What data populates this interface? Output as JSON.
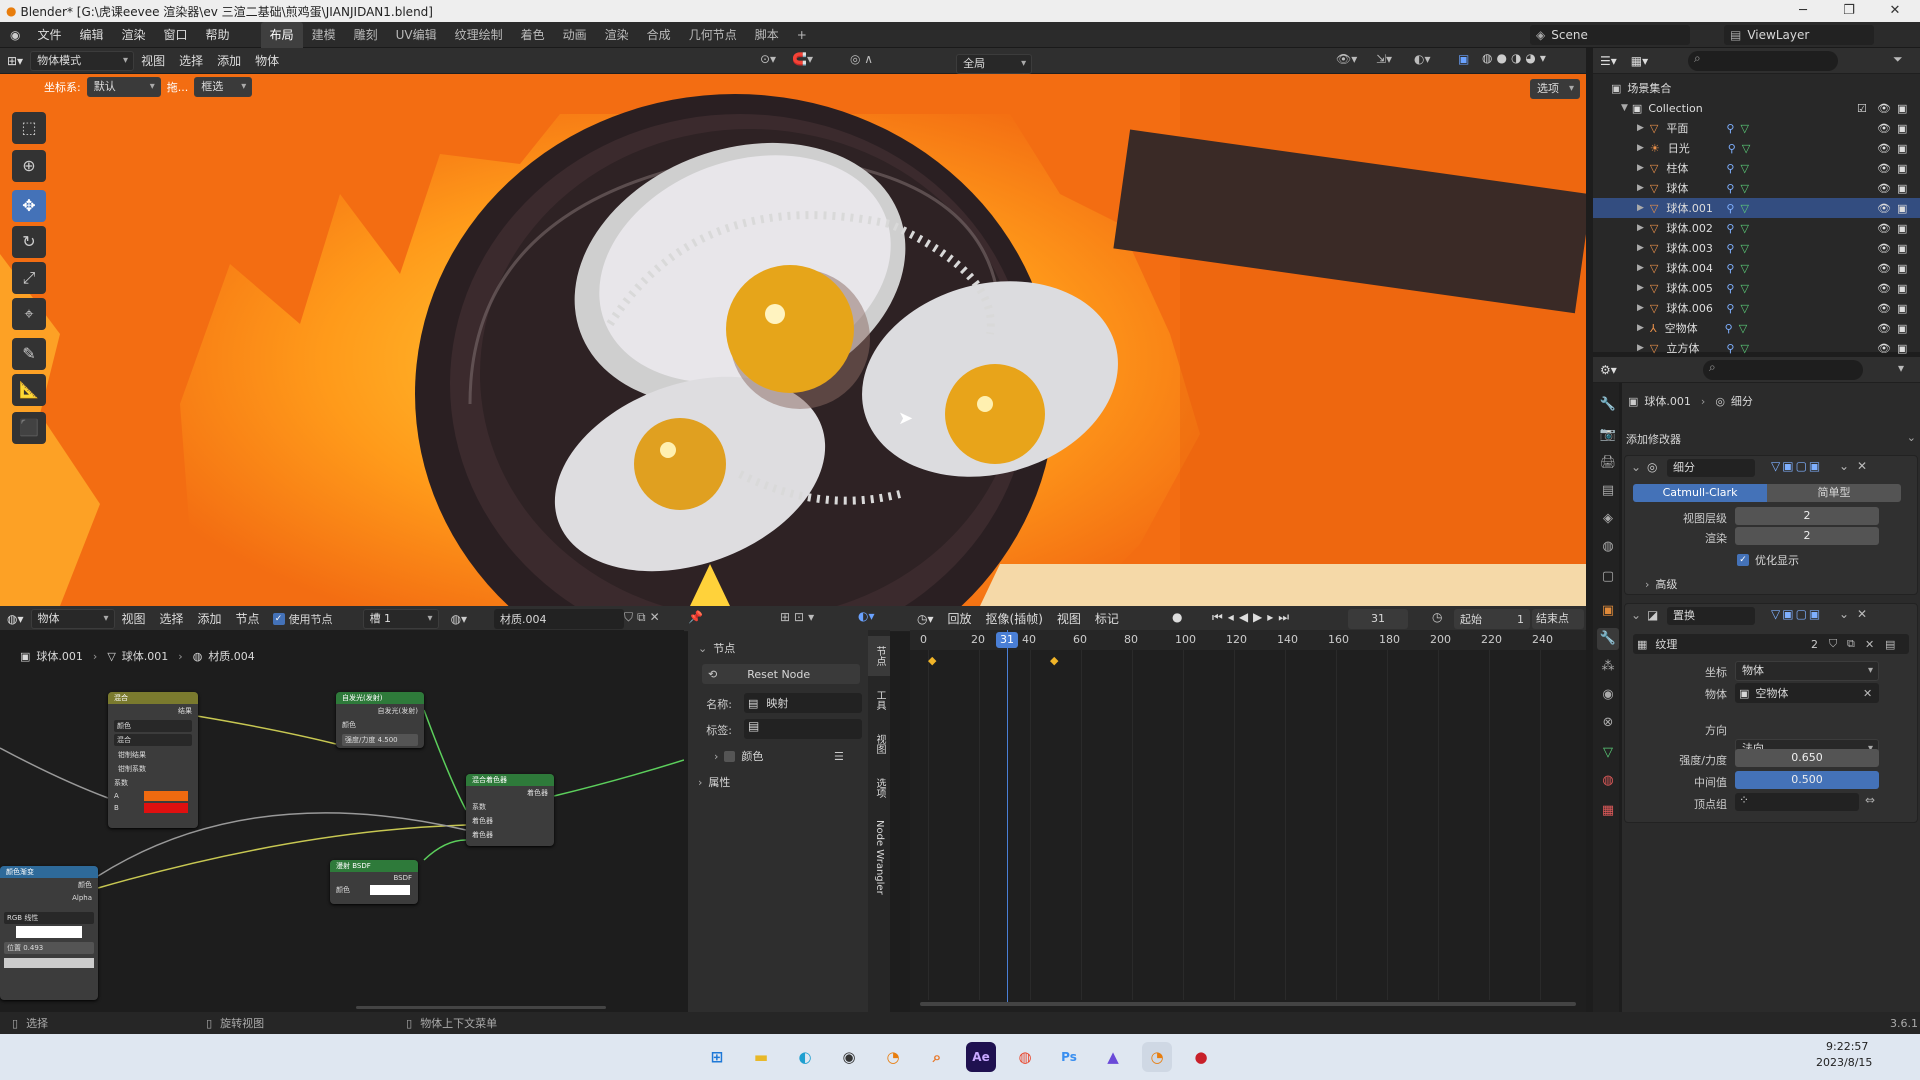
{
  "window": {
    "title": "Blender* [G:\\虎课eevee 渲染器\\ev 三渲二基础\\煎鸡蛋\\JIANJIDAN1.blend]",
    "minimize": "─",
    "maximize": "❐",
    "close": "✕"
  },
  "menu": {
    "items": [
      "文件",
      "编辑",
      "渲染",
      "窗口",
      "帮助"
    ],
    "workspaces": [
      "布局",
      "建模",
      "雕刻",
      "UV编辑",
      "纹理绘制",
      "着色",
      "动画",
      "渲染",
      "合成",
      "几何节点",
      "脚本"
    ],
    "add_ws": "+",
    "scene": "Scene",
    "view_layer": "ViewLayer"
  },
  "viewport_header": {
    "mode": "物体模式",
    "items": [
      "视图",
      "选择",
      "添加",
      "物体"
    ],
    "orient": "全局",
    "options": "选项"
  },
  "viewport_sub": {
    "coord_label": "坐标系:",
    "coord_value": "默认",
    "drag_label": "拖...",
    "select_value": "框选"
  },
  "outliner": {
    "root": "场景集合",
    "collection": "Collection",
    "items": [
      {
        "name": "平面",
        "sel": false
      },
      {
        "name": "日光",
        "sel": false
      },
      {
        "name": "柱体",
        "sel": false
      },
      {
        "name": "球体",
        "sel": false
      },
      {
        "name": "球体.001",
        "sel": true
      },
      {
        "name": "球体.002",
        "sel": false
      },
      {
        "name": "球体.003",
        "sel": false
      },
      {
        "name": "球体.004",
        "sel": false
      },
      {
        "name": "球体.005",
        "sel": false
      },
      {
        "name": "球体.006",
        "sel": false
      },
      {
        "name": "空物体",
        "sel": false
      },
      {
        "name": "立方体",
        "sel": false
      }
    ]
  },
  "properties": {
    "breadcrumb_obj": "球体.001",
    "breadcrumb_mod": "细分",
    "add_modifier": "添加修改器",
    "subsurf": {
      "name": "细分",
      "catmull": "Catmull-Clark",
      "simple": "简单型",
      "levels_label": "视图层级",
      "levels": "2",
      "render_label": "渲染",
      "render": "2",
      "optimal": "优化显示",
      "advanced": "高级"
    },
    "displace": {
      "name": "置换",
      "texture": "纹理",
      "users": "2",
      "coord_label": "坐标",
      "coord": "物体",
      "object_label": "物体",
      "object": "空物体",
      "direction_label": "方向",
      "direction": "法向",
      "strength_label": "强度/力度",
      "strength": "0.650",
      "midlevel_label": "中间值",
      "midlevel": "0.500",
      "vgroup_label": "顶点组"
    }
  },
  "node_header": {
    "type": "物体",
    "items": [
      "视图",
      "选择",
      "添加",
      "节点"
    ],
    "use_nodes": "使用节点",
    "slot": "槽 1",
    "material": "材质.004"
  },
  "node_breadcrumb": [
    "球体.001",
    "球体.001",
    "材质.004"
  ],
  "nodes": [
    {
      "title": "混合",
      "rows": [
        "结果",
        "颜色",
        "混合",
        "钳制结果",
        "钳制系数",
        "系数",
        "A",
        "B"
      ]
    },
    {
      "title": "自发光(发射)",
      "rows": [
        "自发光(发射)",
        "颜色",
        "强度/力度  4.500"
      ]
    },
    {
      "title": "混合着色器",
      "rows": [
        "着色器",
        "系数",
        "着色器",
        "着色器"
      ]
    },
    {
      "title": "漫射 BSDF",
      "rows": [
        "BSDF",
        "颜色"
      ]
    },
    {
      "title": "颜色渐变",
      "rows": [
        "颜色",
        "Alpha",
        "RGB  线性",
        "位置  0.493"
      ]
    }
  ],
  "npanel": {
    "section": "节点",
    "reset": "Reset Node",
    "name_label": "名称:",
    "name": "映射",
    "label_label": "标签:",
    "color": "颜色",
    "props": "属性",
    "tabs": [
      "节点",
      "工具",
      "视图",
      "选项",
      "Node Wrangler"
    ]
  },
  "timeline": {
    "items": [
      "回放",
      "抠像(插帧)",
      "视图",
      "标记"
    ],
    "frame": "31",
    "start_label": "起始",
    "start": "1",
    "end_label": "结束点",
    "ticks": [
      "0",
      "20",
      "40",
      "60",
      "80",
      "100",
      "120",
      "140",
      "160",
      "180",
      "200",
      "220",
      "240"
    ],
    "playhead": 31
  },
  "status": {
    "select": "选择",
    "rotate": "旋转视图",
    "context": "物体上下文菜单",
    "version": "3.6.1"
  },
  "taskbar": {
    "time": "9:22:57",
    "date": "2023/8/15"
  },
  "colors": {
    "accent": "#4472b8",
    "orange": "#f36d12",
    "header": "#2f2f2f"
  }
}
